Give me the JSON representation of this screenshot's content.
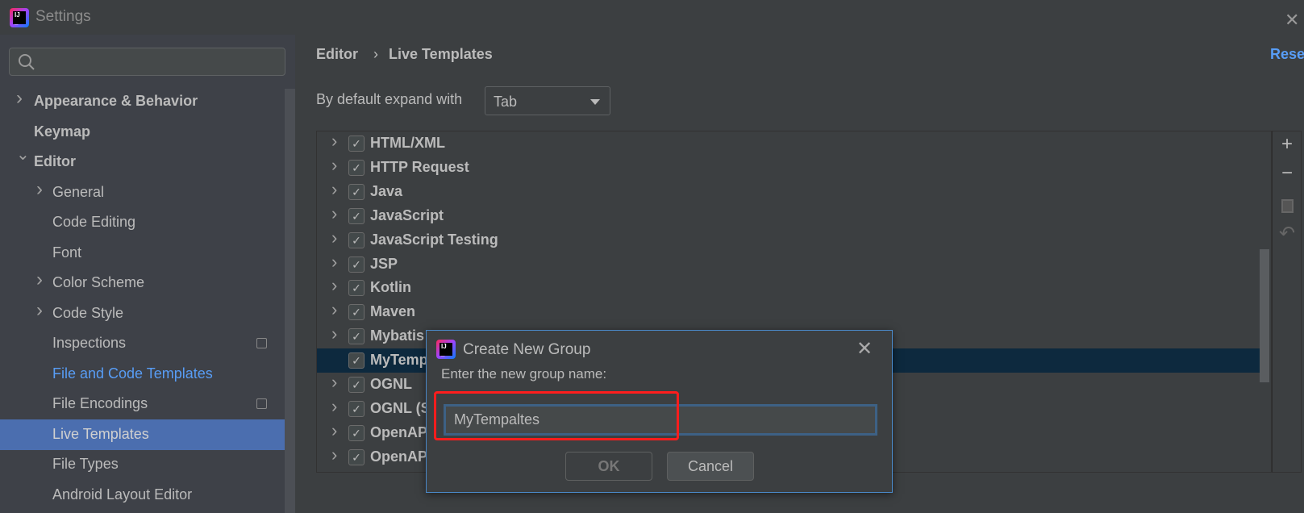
{
  "window": {
    "title": "Settings",
    "close_icon": "close-icon"
  },
  "sidebar": {
    "search_placeholder": "",
    "items": [
      {
        "label": "Appearance & Behavior",
        "level": 0,
        "bold": true,
        "chevron": ">"
      },
      {
        "label": "Keymap",
        "level": 0,
        "bold": true,
        "chevron": ""
      },
      {
        "label": "Editor",
        "level": 0,
        "bold": true,
        "chevron": "v"
      },
      {
        "label": "General",
        "level": 1,
        "chevron": ">"
      },
      {
        "label": "Code Editing",
        "level": 1,
        "chevron": ""
      },
      {
        "label": "Font",
        "level": 1,
        "chevron": ""
      },
      {
        "label": "Color Scheme",
        "level": 1,
        "chevron": ">"
      },
      {
        "label": "Code Style",
        "level": 1,
        "chevron": ">"
      },
      {
        "label": "Inspections",
        "level": 1,
        "chevron": "",
        "project_icon": true
      },
      {
        "label": "File and Code Templates",
        "level": 1,
        "chevron": "",
        "link": true
      },
      {
        "label": "File Encodings",
        "level": 1,
        "chevron": "",
        "project_icon": true
      },
      {
        "label": "Live Templates",
        "level": 1,
        "chevron": "",
        "selected": true
      },
      {
        "label": "File Types",
        "level": 1,
        "chevron": ""
      },
      {
        "label": "Android Layout Editor",
        "level": 1,
        "chevron": ""
      }
    ]
  },
  "header": {
    "breadcrumb": [
      "Editor",
      "Live Templates"
    ],
    "separator": "›",
    "reset": "Reset"
  },
  "expand": {
    "label": "By default expand with",
    "value": "Tab"
  },
  "template_groups": [
    {
      "name": "HTML/XML",
      "checked": true
    },
    {
      "name": "HTTP Request",
      "checked": true
    },
    {
      "name": "Java",
      "checked": true
    },
    {
      "name": "JavaScript",
      "checked": true
    },
    {
      "name": "JavaScript Testing",
      "checked": true
    },
    {
      "name": "JSP",
      "checked": true
    },
    {
      "name": "Kotlin",
      "checked": true
    },
    {
      "name": "Maven",
      "checked": true
    },
    {
      "name": "Mybatis",
      "checked": true
    },
    {
      "name": "MyTemp",
      "checked": true,
      "selected": true,
      "leaf": true
    },
    {
      "name": "OGNL",
      "checked": true
    },
    {
      "name": "OGNL (S",
      "checked": true
    },
    {
      "name": "OpenAP",
      "checked": true
    },
    {
      "name": "OpenAP",
      "checked": true
    }
  ],
  "toolbar": {
    "add": "+",
    "remove": "−",
    "copy_icon": "copy-icon",
    "restore_icon": "undo-icon"
  },
  "dialog": {
    "title": "Create New Group",
    "label": "Enter the new group name:",
    "value": "MyTempaltes",
    "ok": "OK",
    "cancel": "Cancel"
  },
  "colors": {
    "accent": "#4b6eaf",
    "link": "#589df6",
    "highlight": "#ff1d1d",
    "selected_row": "#0d293e"
  }
}
